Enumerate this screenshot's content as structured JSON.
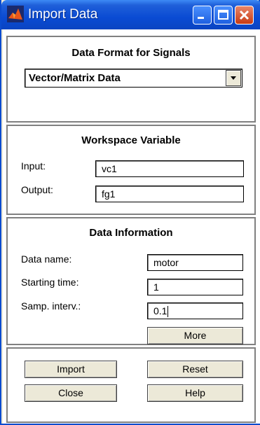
{
  "window": {
    "title": "Import Data"
  },
  "data_format": {
    "title": "Data Format for Signals",
    "selected": "Vector/Matrix Data"
  },
  "workspace": {
    "title": "Workspace Variable",
    "input_label": "Input:",
    "input_value": "vc1",
    "output_label": "Output:",
    "output_value": "fg1"
  },
  "data_info": {
    "title": "Data Information",
    "name_label": "Data name:",
    "name_value": "motor",
    "start_label": "Starting time:",
    "start_value": "1",
    "samp_label": "Samp. interv.:",
    "samp_value": "0.1",
    "more_label": "More"
  },
  "buttons": {
    "import": "Import",
    "reset": "Reset",
    "close": "Close",
    "help": "Help"
  }
}
